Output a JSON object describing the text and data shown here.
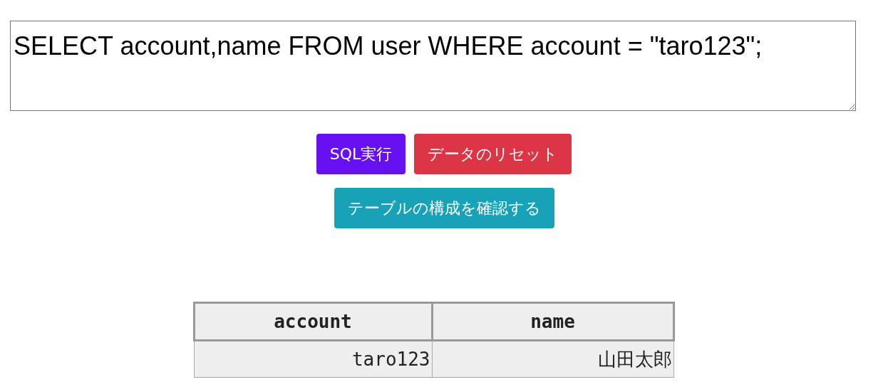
{
  "query": {
    "value": "SELECT account,name FROM user WHERE account = \"taro123\";"
  },
  "button_rows": [
    [
      {
        "label": "SQL実行",
        "color": "#6610f2"
      },
      {
        "label": "データのリセット",
        "color": "#dc3545"
      }
    ],
    [
      {
        "label": "テーブルの構成を確認する",
        "color": "#17a2b8"
      }
    ]
  ],
  "result_table": {
    "columns": [
      "account",
      "name"
    ],
    "rows": [
      [
        "taro123",
        "山田太郎"
      ]
    ]
  }
}
